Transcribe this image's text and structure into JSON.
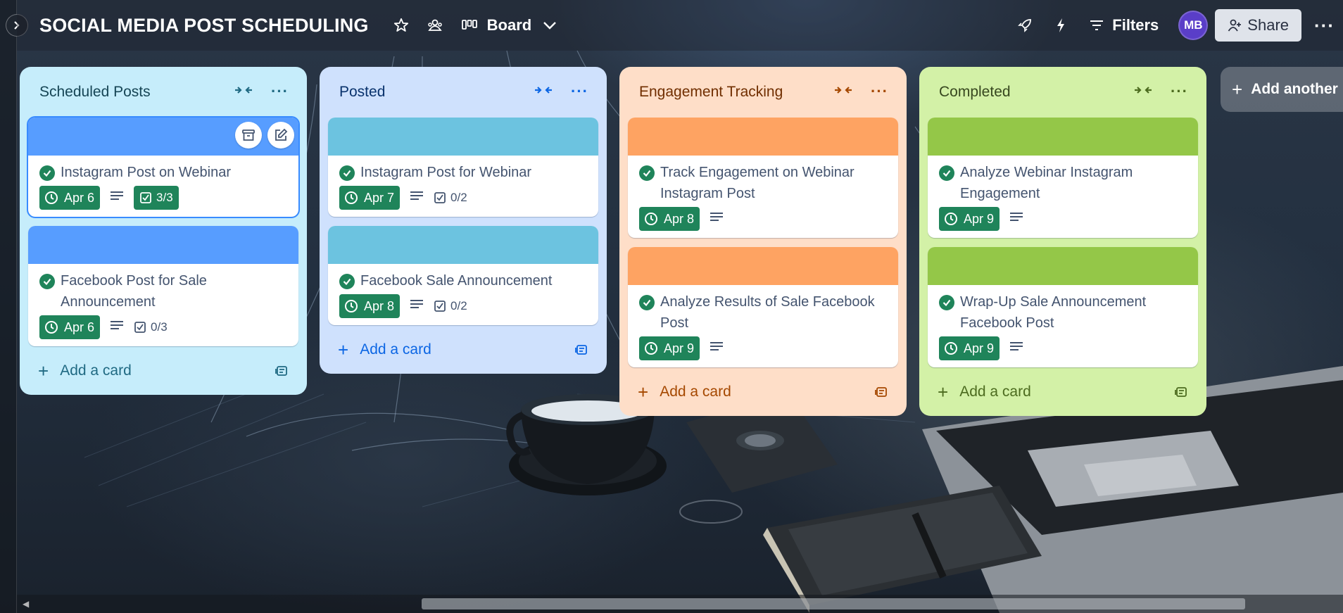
{
  "board": {
    "title": "SOCIAL MEDIA POST SCHEDULING",
    "view_label": "Board",
    "filters_label": "Filters",
    "share_label": "Share",
    "avatar_initials": "MB",
    "more": "···",
    "add_list_label": "Add another"
  },
  "lists": [
    {
      "title": "Scheduled Posts",
      "bg": "#c6edfb",
      "head_color": "#164555",
      "accent": "#206a83",
      "cards": [
        {
          "title": "Instagram Post on Webinar",
          "cover": "#579dff",
          "date": "Apr 6",
          "checklist": "3/3",
          "checklist_complete": true,
          "selected": true
        },
        {
          "title": "Facebook Post for Sale Announcement",
          "cover": "#579dff",
          "date": "Apr 6",
          "checklist": "0/3",
          "checklist_complete": false
        }
      ],
      "add_card_label": "Add a card"
    },
    {
      "title": "Posted",
      "bg": "#cfe1fd",
      "head_color": "#09326c",
      "accent": "#0c66e4",
      "cards": [
        {
          "title": "Instagram Post for Webinar",
          "cover": "#6cc3e0",
          "date": "Apr 7",
          "checklist": "0/2",
          "checklist_complete": false
        },
        {
          "title": "Facebook Sale Announcement",
          "cover": "#6cc3e0",
          "date": "Apr 8",
          "checklist": "0/2",
          "checklist_complete": false
        }
      ],
      "add_card_label": "Add a card"
    },
    {
      "title": "Engagement Tracking",
      "bg": "#fedec8",
      "head_color": "#702e00",
      "accent": "#a54800",
      "cards": [
        {
          "title": "Track Engagement on Webinar Instagram Post",
          "cover": "#fea362",
          "date": "Apr 8"
        },
        {
          "title": "Analyze Results of Sale Facebook Post",
          "cover": "#fea362",
          "date": "Apr 9"
        }
      ],
      "add_card_label": "Add a card"
    },
    {
      "title": "Completed",
      "bg": "#d3f1a7",
      "head_color": "#37471f",
      "accent": "#4c6b1f",
      "cards": [
        {
          "title": "Analyze Webinar Instagram Engagement",
          "cover": "#94c748",
          "date": "Apr 9"
        },
        {
          "title": "Wrap-Up Sale Announcement Facebook Post",
          "cover": "#94c748",
          "date": "Apr 9"
        }
      ],
      "add_card_label": "Add a card"
    }
  ]
}
